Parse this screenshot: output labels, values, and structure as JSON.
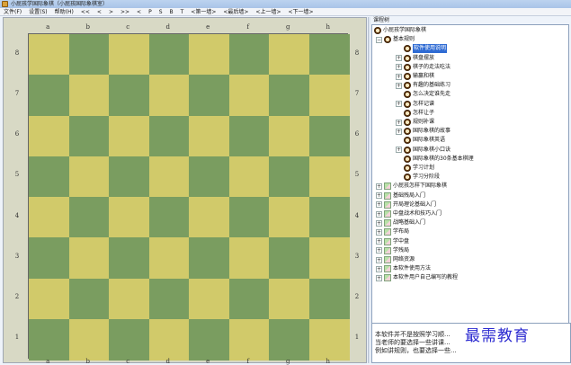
{
  "window": {
    "title": "小屁孩学国际象棋（小屁孩国际象棋室）"
  },
  "menu": [
    "文件(F)",
    "设置(S)",
    "帮助(H)",
    "<<",
    "<",
    ">",
    ">>",
    "<",
    "P",
    "S",
    "B",
    "T",
    "<第一墙>",
    "<最后墙>",
    "<上一墙>",
    "<下一墙>"
  ],
  "board": {
    "files": [
      "a",
      "b",
      "c",
      "d",
      "e",
      "f",
      "g",
      "h"
    ],
    "ranks": [
      "8",
      "7",
      "6",
      "5",
      "4",
      "3",
      "2",
      "1"
    ],
    "light_color": "#d1ca6a",
    "dark_color": "#7a9d60"
  },
  "tree": {
    "header": "课程树",
    "nodes": [
      {
        "label": "小屁孩学国际象棋",
        "level": 0,
        "icon": "clock-icon",
        "expander": ""
      },
      {
        "label": "基本规则",
        "level": 1,
        "icon": "clock-icon",
        "expander": "-"
      },
      {
        "label": "软件使用说明",
        "level": 2,
        "icon": "clock-icon",
        "expander": "",
        "selected": true
      },
      {
        "label": "棋盘摆放",
        "level": 2,
        "icon": "clock-icon",
        "expander": "+"
      },
      {
        "label": "棋子的走法吃法",
        "level": 2,
        "icon": "clock-icon",
        "expander": "+"
      },
      {
        "label": "输赢和棋",
        "level": 2,
        "icon": "clock-icon",
        "expander": "+"
      },
      {
        "label": "有趣的基础练习",
        "level": 2,
        "icon": "clock-icon",
        "expander": "+"
      },
      {
        "label": "怎么决定谁先走",
        "level": 2,
        "icon": "clock-icon",
        "expander": ""
      },
      {
        "label": "怎样记谱",
        "level": 2,
        "icon": "clock-icon",
        "expander": "+"
      },
      {
        "label": "怎样让子",
        "level": 2,
        "icon": "clock-icon",
        "expander": ""
      },
      {
        "label": "规则补课",
        "level": 2,
        "icon": "clock-icon",
        "expander": "+"
      },
      {
        "label": "国际象棋的故事",
        "level": 2,
        "icon": "clock-icon",
        "expander": "+"
      },
      {
        "label": "国际象棋英语",
        "level": 2,
        "icon": "clock-icon",
        "expander": ""
      },
      {
        "label": "国际象棋小口诀",
        "level": 2,
        "icon": "clock-icon",
        "expander": "+"
      },
      {
        "label": "国际象棋的30条基本棋理",
        "level": 2,
        "icon": "clock-icon",
        "expander": ""
      },
      {
        "label": "学习计划",
        "level": 2,
        "icon": "clock-icon",
        "expander": ""
      },
      {
        "label": "学习分阶段",
        "level": 2,
        "icon": "clock-icon",
        "expander": ""
      },
      {
        "label": "小屁孩怎样下国际象棋",
        "level": 1,
        "icon": "book-icon",
        "expander": "+"
      },
      {
        "label": "基础残局入门",
        "level": 1,
        "icon": "book-icon",
        "expander": "+"
      },
      {
        "label": "开局理论基础入门",
        "level": 1,
        "icon": "book-icon",
        "expander": "+"
      },
      {
        "label": "中盘战术和技巧入门",
        "level": 1,
        "icon": "book-icon",
        "expander": "+"
      },
      {
        "label": "战略基础入门",
        "level": 1,
        "icon": "book-icon",
        "expander": "+"
      },
      {
        "label": "学布局",
        "level": 1,
        "icon": "book-icon",
        "expander": "+"
      },
      {
        "label": "学中盘",
        "level": 1,
        "icon": "book-icon",
        "expander": "+"
      },
      {
        "label": "学残局",
        "level": 1,
        "icon": "book-icon",
        "expander": "+"
      },
      {
        "label": "网络资源",
        "level": 1,
        "icon": "book-icon",
        "expander": "+"
      },
      {
        "label": "本软件使用方法",
        "level": 1,
        "icon": "book-icon",
        "expander": "+"
      },
      {
        "label": "本软件用户自己编写的教程",
        "level": 1,
        "icon": "book-icon",
        "expander": "+"
      }
    ]
  },
  "description": {
    "lines": [
      "本软件并不是按照学习顺...",
      "当老师的要选择一些讲课...",
      "例如讲规则，也要选择一些..."
    ]
  },
  "watermark": "最需教育"
}
